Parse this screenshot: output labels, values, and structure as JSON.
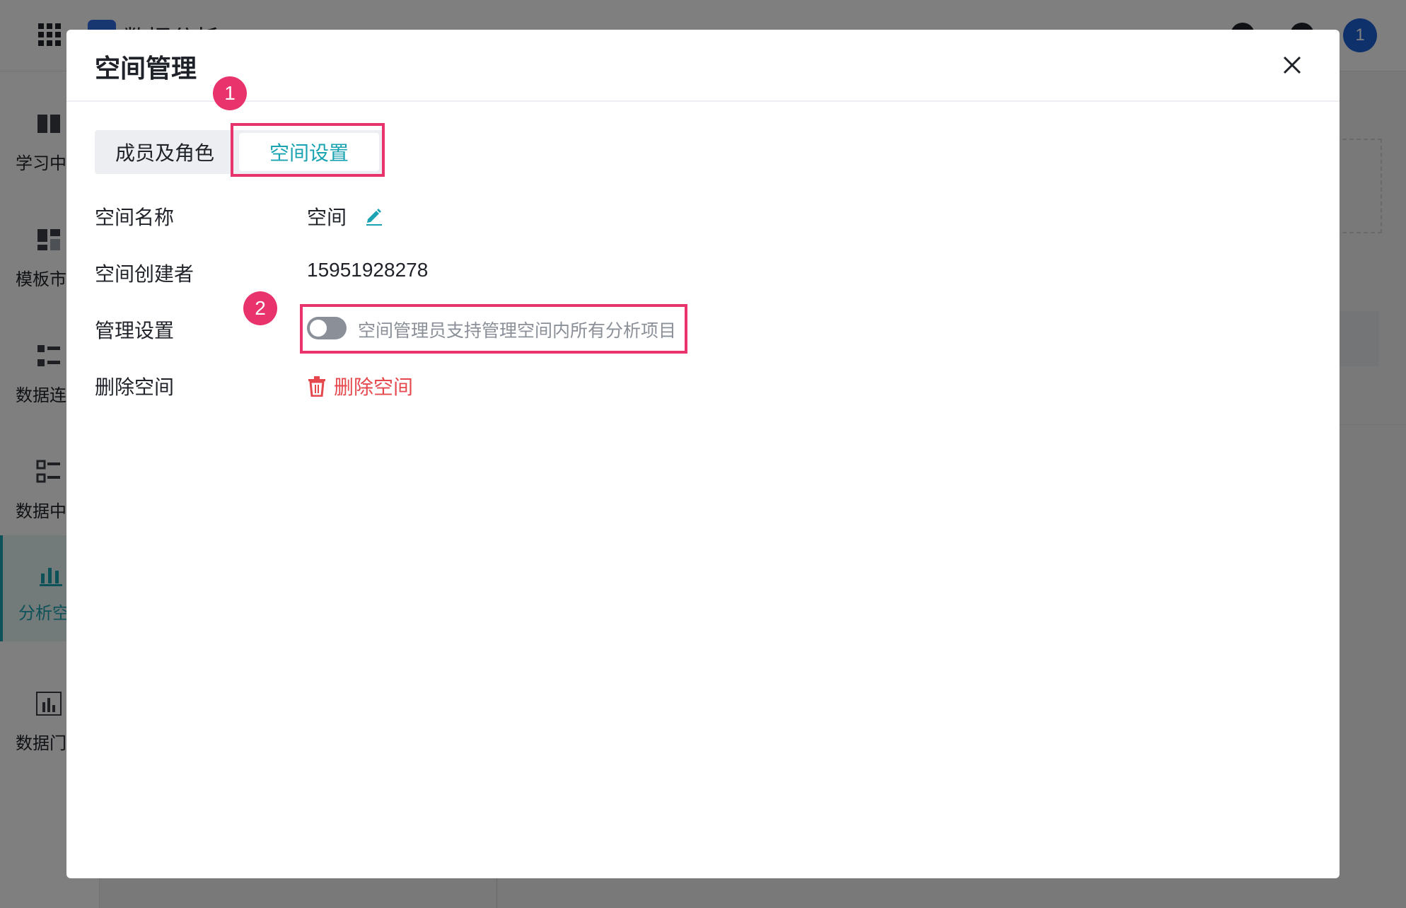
{
  "app": {
    "title": "数据分析",
    "avatar_text": "1",
    "sidebar": [
      {
        "label": "学习中"
      },
      {
        "label": "模板市"
      },
      {
        "label": "数据连"
      },
      {
        "label": "数据中"
      },
      {
        "label": "分析空",
        "active": true
      },
      {
        "label": "数据门"
      }
    ]
  },
  "modal": {
    "title": "空间管理",
    "tabs": [
      {
        "label": "成员及角色",
        "active": false
      },
      {
        "label": "空间设置",
        "active": true
      }
    ],
    "rows": {
      "name_label": "空间名称",
      "name_value": "空间",
      "creator_label": "空间创建者",
      "creator_value": "15951928278",
      "manage_label": "管理设置",
      "manage_toggle_text": "空间管理员支持管理空间内所有分析项目",
      "manage_toggle_on": false,
      "delete_label": "删除空间",
      "delete_link": "删除空间"
    }
  },
  "annotations": {
    "badge1": "1",
    "badge2": "2"
  },
  "colors": {
    "accent": "#1aa3b2",
    "danger": "#e5484d",
    "annotation": "#e8336d"
  }
}
